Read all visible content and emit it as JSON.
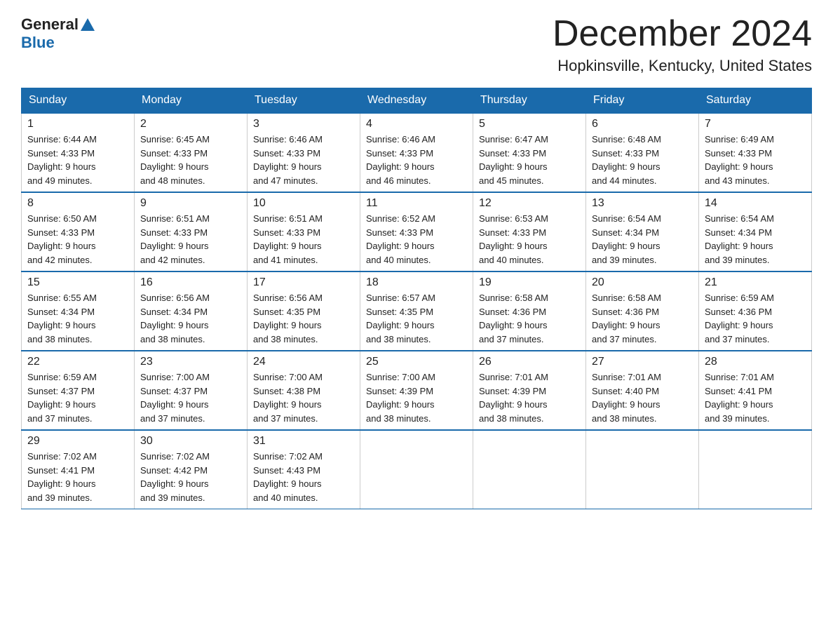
{
  "header": {
    "logo_general": "General",
    "logo_blue": "Blue",
    "month_title": "December 2024",
    "location": "Hopkinsville, Kentucky, United States"
  },
  "weekdays": [
    "Sunday",
    "Monday",
    "Tuesday",
    "Wednesday",
    "Thursday",
    "Friday",
    "Saturday"
  ],
  "weeks": [
    [
      {
        "day": "1",
        "sunrise": "6:44 AM",
        "sunset": "4:33 PM",
        "daylight": "9 hours and 49 minutes."
      },
      {
        "day": "2",
        "sunrise": "6:45 AM",
        "sunset": "4:33 PM",
        "daylight": "9 hours and 48 minutes."
      },
      {
        "day": "3",
        "sunrise": "6:46 AM",
        "sunset": "4:33 PM",
        "daylight": "9 hours and 47 minutes."
      },
      {
        "day": "4",
        "sunrise": "6:46 AM",
        "sunset": "4:33 PM",
        "daylight": "9 hours and 46 minutes."
      },
      {
        "day": "5",
        "sunrise": "6:47 AM",
        "sunset": "4:33 PM",
        "daylight": "9 hours and 45 minutes."
      },
      {
        "day": "6",
        "sunrise": "6:48 AM",
        "sunset": "4:33 PM",
        "daylight": "9 hours and 44 minutes."
      },
      {
        "day": "7",
        "sunrise": "6:49 AM",
        "sunset": "4:33 PM",
        "daylight": "9 hours and 43 minutes."
      }
    ],
    [
      {
        "day": "8",
        "sunrise": "6:50 AM",
        "sunset": "4:33 PM",
        "daylight": "9 hours and 42 minutes."
      },
      {
        "day": "9",
        "sunrise": "6:51 AM",
        "sunset": "4:33 PM",
        "daylight": "9 hours and 42 minutes."
      },
      {
        "day": "10",
        "sunrise": "6:51 AM",
        "sunset": "4:33 PM",
        "daylight": "9 hours and 41 minutes."
      },
      {
        "day": "11",
        "sunrise": "6:52 AM",
        "sunset": "4:33 PM",
        "daylight": "9 hours and 40 minutes."
      },
      {
        "day": "12",
        "sunrise": "6:53 AM",
        "sunset": "4:33 PM",
        "daylight": "9 hours and 40 minutes."
      },
      {
        "day": "13",
        "sunrise": "6:54 AM",
        "sunset": "4:34 PM",
        "daylight": "9 hours and 39 minutes."
      },
      {
        "day": "14",
        "sunrise": "6:54 AM",
        "sunset": "4:34 PM",
        "daylight": "9 hours and 39 minutes."
      }
    ],
    [
      {
        "day": "15",
        "sunrise": "6:55 AM",
        "sunset": "4:34 PM",
        "daylight": "9 hours and 38 minutes."
      },
      {
        "day": "16",
        "sunrise": "6:56 AM",
        "sunset": "4:34 PM",
        "daylight": "9 hours and 38 minutes."
      },
      {
        "day": "17",
        "sunrise": "6:56 AM",
        "sunset": "4:35 PM",
        "daylight": "9 hours and 38 minutes."
      },
      {
        "day": "18",
        "sunrise": "6:57 AM",
        "sunset": "4:35 PM",
        "daylight": "9 hours and 38 minutes."
      },
      {
        "day": "19",
        "sunrise": "6:58 AM",
        "sunset": "4:36 PM",
        "daylight": "9 hours and 37 minutes."
      },
      {
        "day": "20",
        "sunrise": "6:58 AM",
        "sunset": "4:36 PM",
        "daylight": "9 hours and 37 minutes."
      },
      {
        "day": "21",
        "sunrise": "6:59 AM",
        "sunset": "4:36 PM",
        "daylight": "9 hours and 37 minutes."
      }
    ],
    [
      {
        "day": "22",
        "sunrise": "6:59 AM",
        "sunset": "4:37 PM",
        "daylight": "9 hours and 37 minutes."
      },
      {
        "day": "23",
        "sunrise": "7:00 AM",
        "sunset": "4:37 PM",
        "daylight": "9 hours and 37 minutes."
      },
      {
        "day": "24",
        "sunrise": "7:00 AM",
        "sunset": "4:38 PM",
        "daylight": "9 hours and 37 minutes."
      },
      {
        "day": "25",
        "sunrise": "7:00 AM",
        "sunset": "4:39 PM",
        "daylight": "9 hours and 38 minutes."
      },
      {
        "day": "26",
        "sunrise": "7:01 AM",
        "sunset": "4:39 PM",
        "daylight": "9 hours and 38 minutes."
      },
      {
        "day": "27",
        "sunrise": "7:01 AM",
        "sunset": "4:40 PM",
        "daylight": "9 hours and 38 minutes."
      },
      {
        "day": "28",
        "sunrise": "7:01 AM",
        "sunset": "4:41 PM",
        "daylight": "9 hours and 39 minutes."
      }
    ],
    [
      {
        "day": "29",
        "sunrise": "7:02 AM",
        "sunset": "4:41 PM",
        "daylight": "9 hours and 39 minutes."
      },
      {
        "day": "30",
        "sunrise": "7:02 AM",
        "sunset": "4:42 PM",
        "daylight": "9 hours and 39 minutes."
      },
      {
        "day": "31",
        "sunrise": "7:02 AM",
        "sunset": "4:43 PM",
        "daylight": "9 hours and 40 minutes."
      },
      null,
      null,
      null,
      null
    ]
  ]
}
